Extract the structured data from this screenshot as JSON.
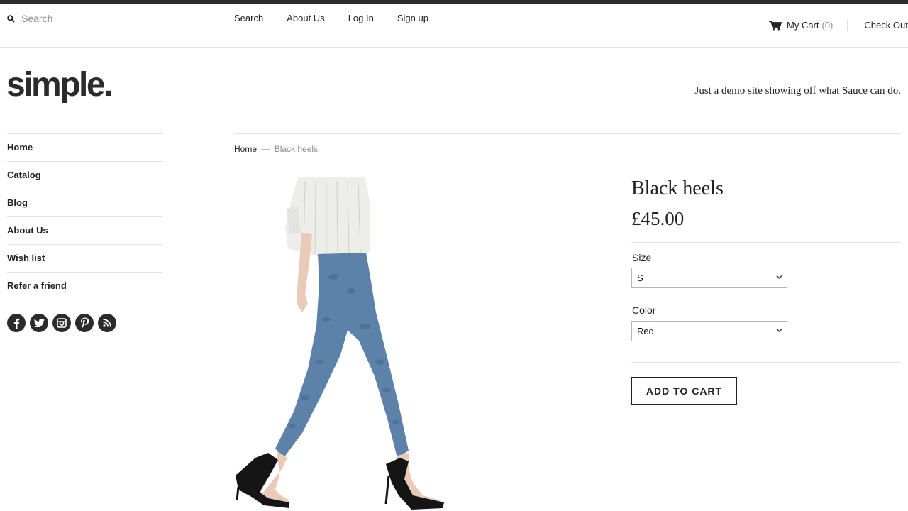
{
  "search": {
    "placeholder": "Search"
  },
  "top_nav": [
    "Search",
    "About Us",
    "Log In",
    "Sign up"
  ],
  "cart": {
    "label": "My Cart",
    "count": "(0)",
    "checkout": "Check Out"
  },
  "logo": "simple.",
  "tagline": "Just a demo site showing off what Sauce can do.",
  "side_nav": [
    "Home",
    "Catalog",
    "Blog",
    "About Us",
    "Wish list",
    "Refer a friend"
  ],
  "social_icons": [
    "facebook-icon",
    "twitter-icon",
    "instagram-icon",
    "pinterest-icon",
    "rss-icon"
  ],
  "breadcrumb": {
    "home": "Home",
    "separator": "—",
    "current": "Black heels"
  },
  "product": {
    "title": "Black heels",
    "price": "£45.00",
    "size_label": "Size",
    "size_value": "S",
    "color_label": "Color",
    "color_value": "Red",
    "add_to_cart": "ADD TO CART"
  },
  "colors": {
    "accent_dark": "#2b2b2b",
    "muted_text": "#8c8c8c",
    "rule": "#e4e4e4"
  }
}
